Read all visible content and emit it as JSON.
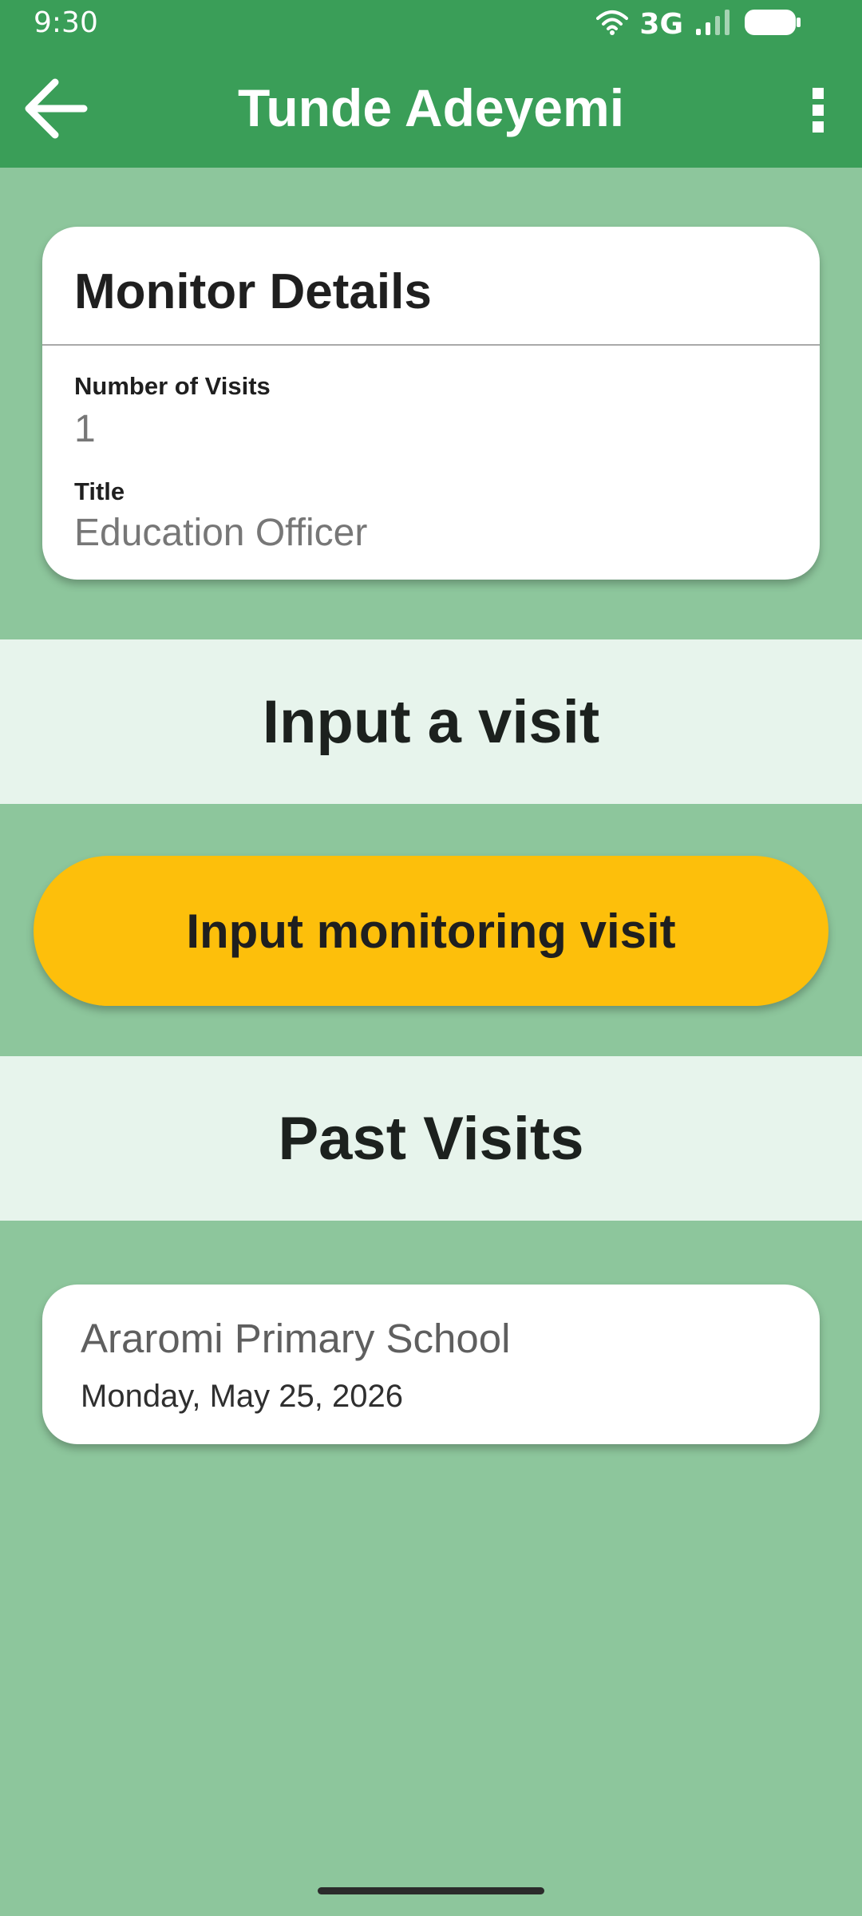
{
  "status_bar": {
    "time": "9:30",
    "network": "3G",
    "icons": [
      "wifi-icon",
      "signal-icon",
      "battery-icon"
    ]
  },
  "app_bar": {
    "title": "Tunde Adeyemi",
    "back_icon": "arrow-left-icon",
    "menu_icon": "more-vert-icon"
  },
  "monitor_details": {
    "heading": "Monitor Details",
    "visits_label": "Number of Visits",
    "visits_value": "1",
    "title_label": "Title",
    "title_value": "Education Officer"
  },
  "input_section": {
    "heading": "Input a visit",
    "button_label": "Input monitoring visit"
  },
  "past_visits": {
    "heading": "Past Visits",
    "items": [
      {
        "school": "Araromi Primary School",
        "date": "Monday, May 25, 2026"
      }
    ]
  },
  "colors": {
    "app_bar": "#3a9e58",
    "background": "#8dc69c",
    "section_band": "#e7f4ec",
    "primary_button": "#fdbf0b"
  }
}
